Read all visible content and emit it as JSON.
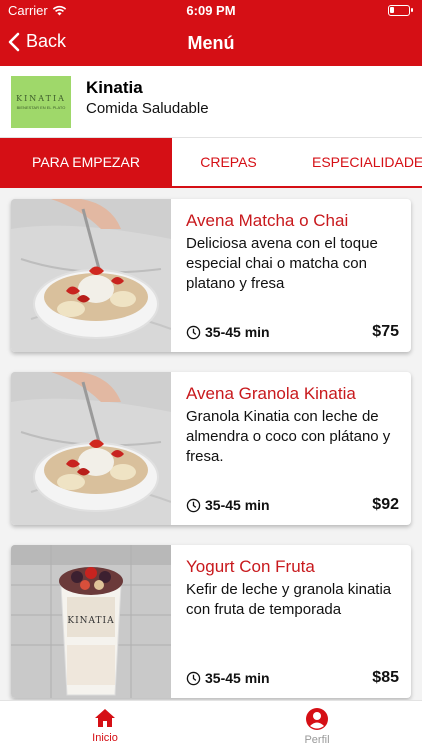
{
  "status_bar": {
    "carrier": "Carrier",
    "time": "6:09 PM"
  },
  "nav": {
    "back_label": "Back",
    "title": "Menú"
  },
  "restaurant": {
    "name": "Kinatia",
    "subtitle": "Comida Saludable",
    "logo_text": "KINATIA",
    "logo_subtext": "BIENESTAR EN EL PLATO"
  },
  "tabs": [
    {
      "label": "PARA EMPEZAR",
      "active": true
    },
    {
      "label": "CREPAS",
      "active": false
    },
    {
      "label": "ESPECIALIDADES",
      "active": false
    }
  ],
  "menu_items": [
    {
      "title": "Avena Matcha o Chai",
      "description": "Deliciosa avena con el toque especial chai o matcha con platano y fresa",
      "time": "35-45 min",
      "price": "$75"
    },
    {
      "title": "Avena Granola Kinatia",
      "description": "Granola Kinatia con leche de almendra o coco con plátano y fresa.",
      "time": "35-45 min",
      "price": "$92"
    },
    {
      "title": "Yogurt Con Fruta",
      "description": "Kefir de leche y granola kinatia con fruta de temporada",
      "time": "35-45 min",
      "price": "$85"
    }
  ],
  "tabbar": {
    "home_label": "Inicio",
    "profile_label": "Perfil"
  },
  "colors": {
    "primary": "#d50f15",
    "title_red": "#c8191d",
    "inactive": "#999999"
  },
  "icons": [
    "wifi-icon",
    "battery-icon",
    "back-chevron-icon",
    "clock-icon",
    "home-icon",
    "profile-icon"
  ]
}
